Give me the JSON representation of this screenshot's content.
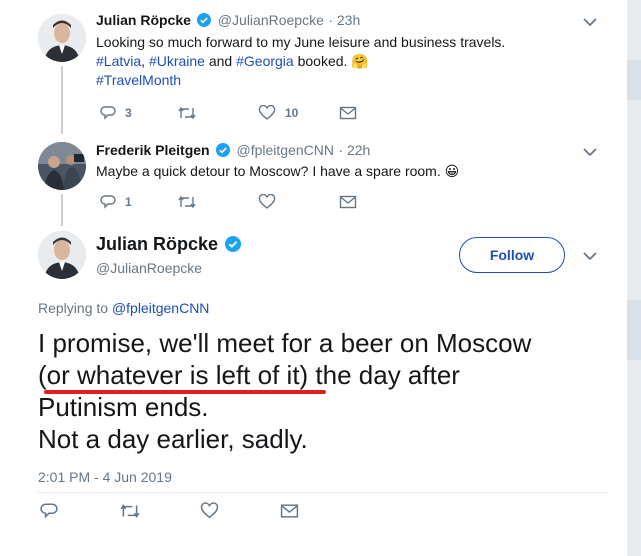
{
  "tweet1": {
    "name": "Julian Röpcke",
    "handle": "@JulianRoepcke",
    "time": "· 23h",
    "line1": "Looking so much forward to my June leisure and business travels.",
    "hashtag1": "#Latvia",
    "sep1": ", ",
    "hashtag2": "#Ukraine",
    "and_text": " and ",
    "hashtag3": "#Georgia",
    "booked": " booked.",
    "emoji": "🤗",
    "hashtag4": "#TravelMonth",
    "replies": "3",
    "likes": "10"
  },
  "tweet2": {
    "name": "Frederik Pleitgen",
    "handle": "@fpleitgenCNN",
    "time": "· 22h",
    "text": "Maybe a quick detour to Moscow? I have a spare room.",
    "emoji": "😀",
    "replies": "1"
  },
  "main_tweet": {
    "name": "Julian Röpcke",
    "handle": "@JulianRoepcke",
    "follow_label": "Follow",
    "replying_prefix": "Replying to ",
    "replying_to": "@fpleitgenCNN",
    "line1": "I promise, we'll meet for a beer on Moscow",
    "line2": "(or whatever is left of it) the day after",
    "line3": "Putinism ends.",
    "line4": "Not a day earlier, sadly.",
    "timestamp": "2:01 PM - 4 Jun 2019"
  },
  "icons": {
    "reply": "reply-icon",
    "retweet": "retweet-icon",
    "like": "heart-icon",
    "dm": "envelope-icon",
    "verified": "verified-badge-icon",
    "chevron": "chevron-down-icon"
  },
  "colors": {
    "link": "#1b4fb5",
    "verified": "#1da1f2",
    "muted": "#657786",
    "underline": "#e0201b"
  }
}
